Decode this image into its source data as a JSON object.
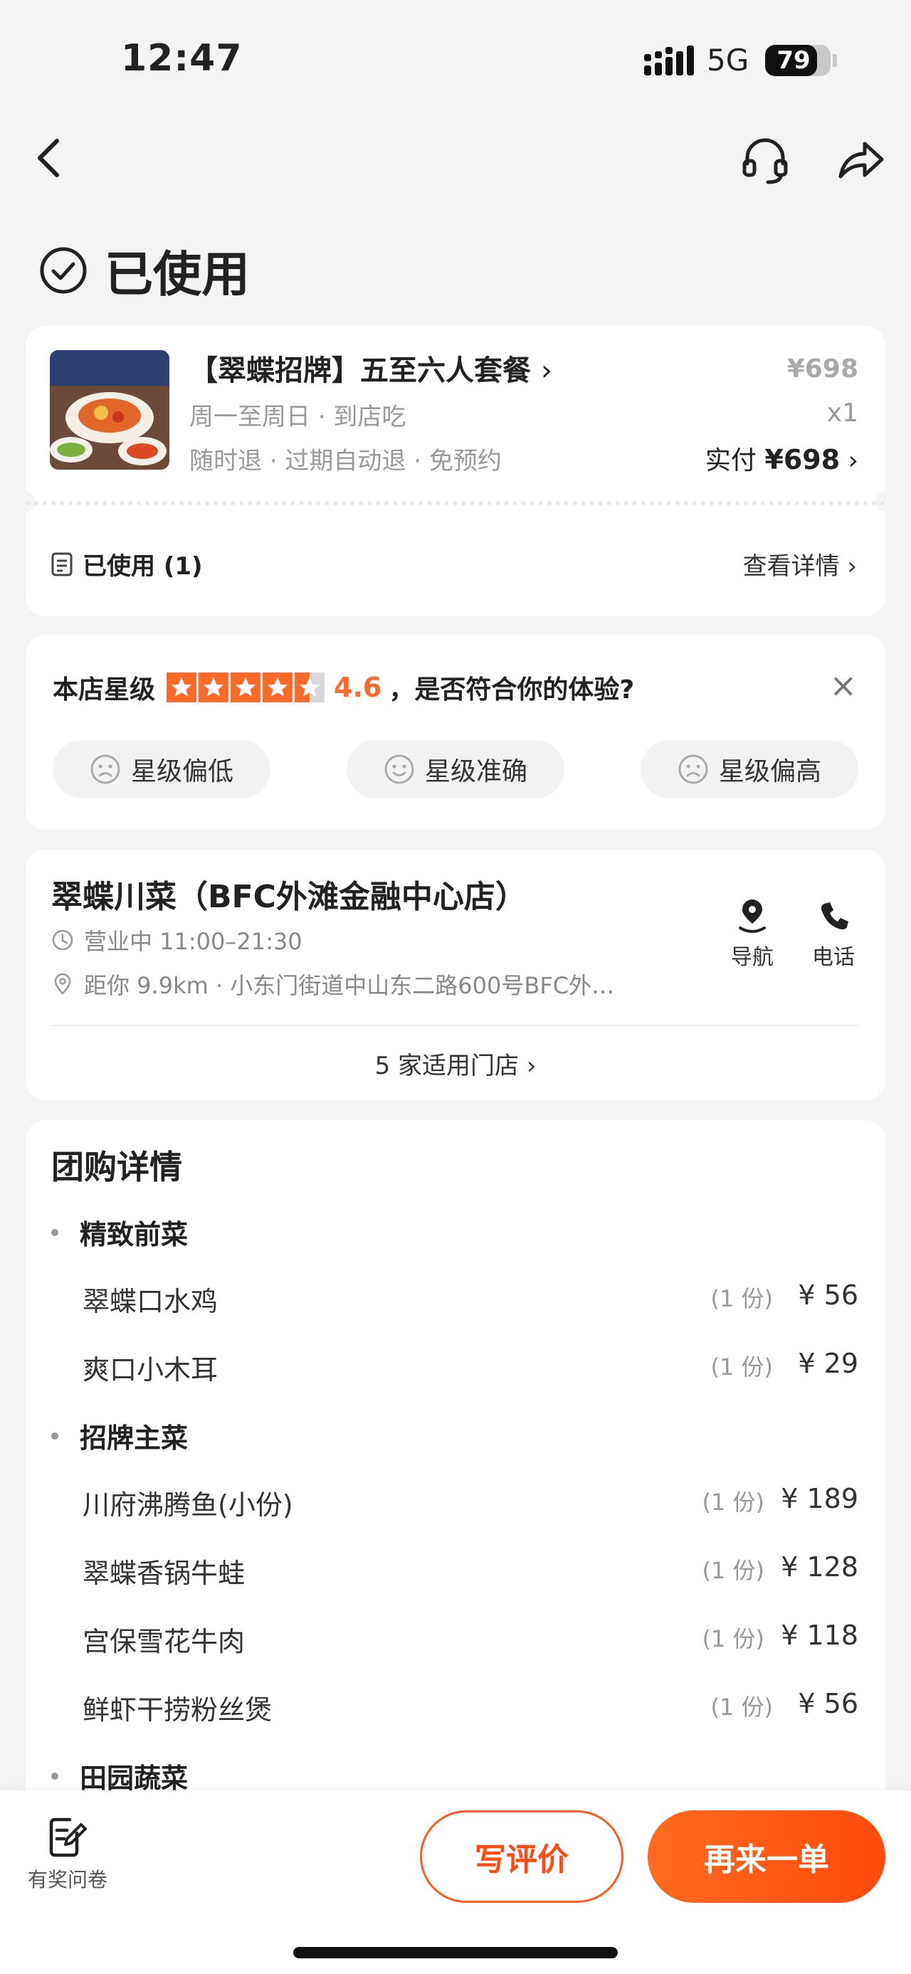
{
  "status_bar": {
    "time": "12:47",
    "network": "5G",
    "battery": "79",
    "battery_level": 0.79
  },
  "header": {
    "status_title": "已使用"
  },
  "order": {
    "title": "【翠蝶招牌】五至六人套餐",
    "title_chevron": "›",
    "subtitle1": "周一至周日 · 到店吃",
    "subtitle2": "随时退 · 过期自动退 · 免预约",
    "original_price": "¥698",
    "quantity": "x1",
    "paid_label": "实付",
    "paid_amount": "¥698",
    "used_label": "已使用 (1)",
    "detail_link": "查看详情 ›"
  },
  "rating": {
    "prefix": "本店星级",
    "stars": 4.5,
    "score": "4.6",
    "question": "，是否符合你的体验?",
    "close": "×",
    "options": [
      "星级偏低",
      "星级准确",
      "星级偏高"
    ]
  },
  "store": {
    "name": "翠蝶川菜（BFC外滩金融中心店）",
    "hours": "营业中 11:00–21:30",
    "address": "距你 9.9km ·  小东门街道中山东二路600号BFC外…",
    "nav_label": "导航",
    "call_label": "电话",
    "stores_link": "5 家适用门店 ›"
  },
  "details": {
    "title": "团购详情",
    "groups": [
      {
        "name": "精致前菜",
        "items": [
          {
            "name": "翠蝶口水鸡",
            "count": "(1 份)",
            "price": "¥ 56"
          },
          {
            "name": "爽口小木耳",
            "count": "(1 份)",
            "price": "¥ 29"
          }
        ]
      },
      {
        "name": "招牌主菜",
        "items": [
          {
            "name": "川府沸腾鱼(小份)",
            "count": "(1 份)",
            "price": "¥ 189"
          },
          {
            "name": "翠蝶香锅牛蛙",
            "count": "(1 份)",
            "price": "¥ 128"
          },
          {
            "name": "宫保雪花牛肉",
            "count": "(1 份)",
            "price": "¥ 118"
          },
          {
            "name": "鲜虾干捞粉丝煲",
            "count": "(1 份)",
            "price": "¥ 56"
          }
        ]
      },
      {
        "name": "田园蔬菜",
        "items": []
      }
    ]
  },
  "bottom_bar": {
    "survey_label": "有奖问卷",
    "review_button": "写评价",
    "reorder_button": "再来一单"
  },
  "colors": {
    "accent": "#ff5a1f",
    "star": "#ff6a2a",
    "background": "#f4f4f4"
  }
}
